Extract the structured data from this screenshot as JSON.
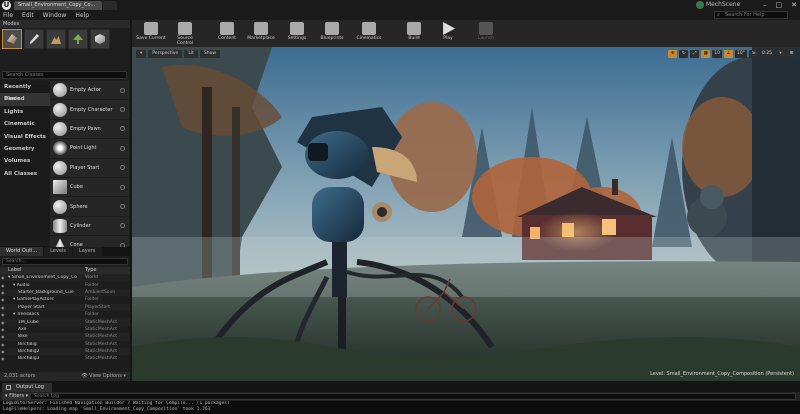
{
  "window": {
    "doc_tab": "Small_Environment_Copy_Co...",
    "project": "MechScene",
    "controls": [
      "–",
      "□",
      "✕"
    ]
  },
  "menu": [
    "File",
    "Edit",
    "Window",
    "Help"
  ],
  "search_help_placeholder": "Search For Help",
  "modes": {
    "title": "Modes",
    "search_placeholder": "Search Classes",
    "categories": [
      "Recently Placed",
      "Basic",
      "Lights",
      "Cinematic",
      "Visual Effects",
      "Geometry",
      "Volumes",
      "All Classes"
    ],
    "selected_category": "Basic",
    "classes": [
      "Empty Actor",
      "Empty Character",
      "Empty Pawn",
      "Point Light",
      "Player Start",
      "Cube",
      "Sphere",
      "Cylinder",
      "Cone"
    ]
  },
  "outliner": {
    "tabs": [
      "World Outl...",
      "Levels",
      "Layers"
    ],
    "search_placeholder": "Search...",
    "col_label": "Label",
    "col_type": "Type",
    "rows": [
      {
        "label": "▾ Small_Environment_Copy_Co",
        "type": "World",
        "indent": 0
      },
      {
        "label": "▾ Audio",
        "type": "Folder",
        "indent": 1
      },
      {
        "label": "Starter_Background_Cue",
        "type": "AmbientSoun",
        "indent": 2
      },
      {
        "label": "▾ GamePlayActors",
        "type": "Folder",
        "indent": 1
      },
      {
        "label": "Player Start",
        "type": "PlayerStart",
        "indent": 2
      },
      {
        "label": "▾ TreesBack",
        "type": "Folder",
        "indent": 1
      },
      {
        "label": "1M_Cube",
        "type": "StaticMeshAct",
        "indent": 2
      },
      {
        "label": "Axe",
        "type": "StaticMeshAct",
        "indent": 2
      },
      {
        "label": "Bike",
        "type": "StaticMeshAct",
        "indent": 2
      },
      {
        "label": "BirchBig",
        "type": "StaticMeshAct",
        "indent": 2
      },
      {
        "label": "BirchBig2",
        "type": "StaticMeshAct",
        "indent": 2
      },
      {
        "label": "BirchBig3",
        "type": "StaticMeshAct",
        "indent": 2
      }
    ],
    "actor_count": "2,031 actors",
    "view_options": "👁 View Options ▾"
  },
  "toolbar": [
    {
      "label": "Save Current",
      "icon": "save-icon"
    },
    {
      "label": "Source Control",
      "icon": "source-control-icon"
    },
    {
      "label": "Content",
      "icon": "content-icon"
    },
    {
      "label": "Marketplace",
      "icon": "marketplace-icon"
    },
    {
      "label": "Settings",
      "icon": "gear-icon"
    },
    {
      "label": "Blueprints",
      "icon": "blueprint-icon"
    },
    {
      "label": "Cinematics",
      "icon": "clapper-icon"
    },
    {
      "label": "Build",
      "icon": "build-icon"
    },
    {
      "label": "Play",
      "icon": "play-icon"
    },
    {
      "label": "Launch",
      "icon": "launch-icon"
    }
  ],
  "viewport": {
    "buttons_left": [
      "▾",
      "Perspective",
      "Lit",
      "Show"
    ],
    "buttons_right": [
      "⊕",
      "↻",
      "⤢",
      "▦",
      "10",
      "∠",
      "10°",
      "⇲",
      "0.25",
      "▾",
      "⊞"
    ],
    "level_text": "Level:  Small_Environment_Copy_Composition (Persistent)",
    "colors": {
      "sky_top": "#3f6f93",
      "sky_glow": "#b7c7c9",
      "window_light": "#f2b36a",
      "foliage_orange": "#b1643a"
    }
  },
  "output_log": {
    "tab": "Output Log",
    "filters": "▾ Filters ▾",
    "search_placeholder": "Search Log",
    "lines": [
      "LogEditorServer: Finished Navigation Builder / Waiting for Compile... (1 packages)",
      "LogFileHelpers: Loading map 'Small_Environment_Copy_Composition' took 1.763"
    ]
  }
}
